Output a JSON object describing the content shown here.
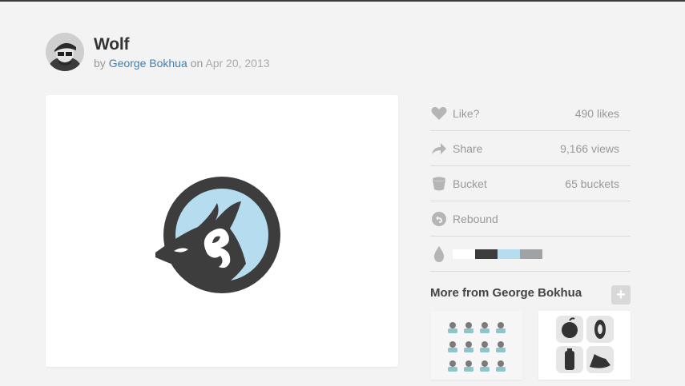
{
  "shot": {
    "title": "Wolf",
    "by_label": "by",
    "author": "George Bokhua",
    "on_label": "on",
    "date": "Apr 20, 2013"
  },
  "stats": [
    {
      "label": "Like?",
      "value": "490 likes",
      "icon": "heart-icon"
    },
    {
      "label": "Share",
      "value": "9,166 views",
      "icon": "share-arrow-icon"
    },
    {
      "label": "Bucket",
      "value": "65 buckets",
      "icon": "bucket-icon"
    },
    {
      "label": "Rebound",
      "value": "",
      "icon": "rebound-icon"
    }
  ],
  "palette": {
    "icon": "color-drop-icon",
    "colors": [
      "#ffffff",
      "#3d3d3d",
      "#b5dcef",
      "#a0a3a6"
    ]
  },
  "more": {
    "title": "More from George Bokhua",
    "add_symbol": "+"
  },
  "colors": {
    "background": "#f3f3f3",
    "link": "#3f7fb3",
    "logo_dark": "#3d3d3d",
    "logo_light": "#b5dcef"
  }
}
